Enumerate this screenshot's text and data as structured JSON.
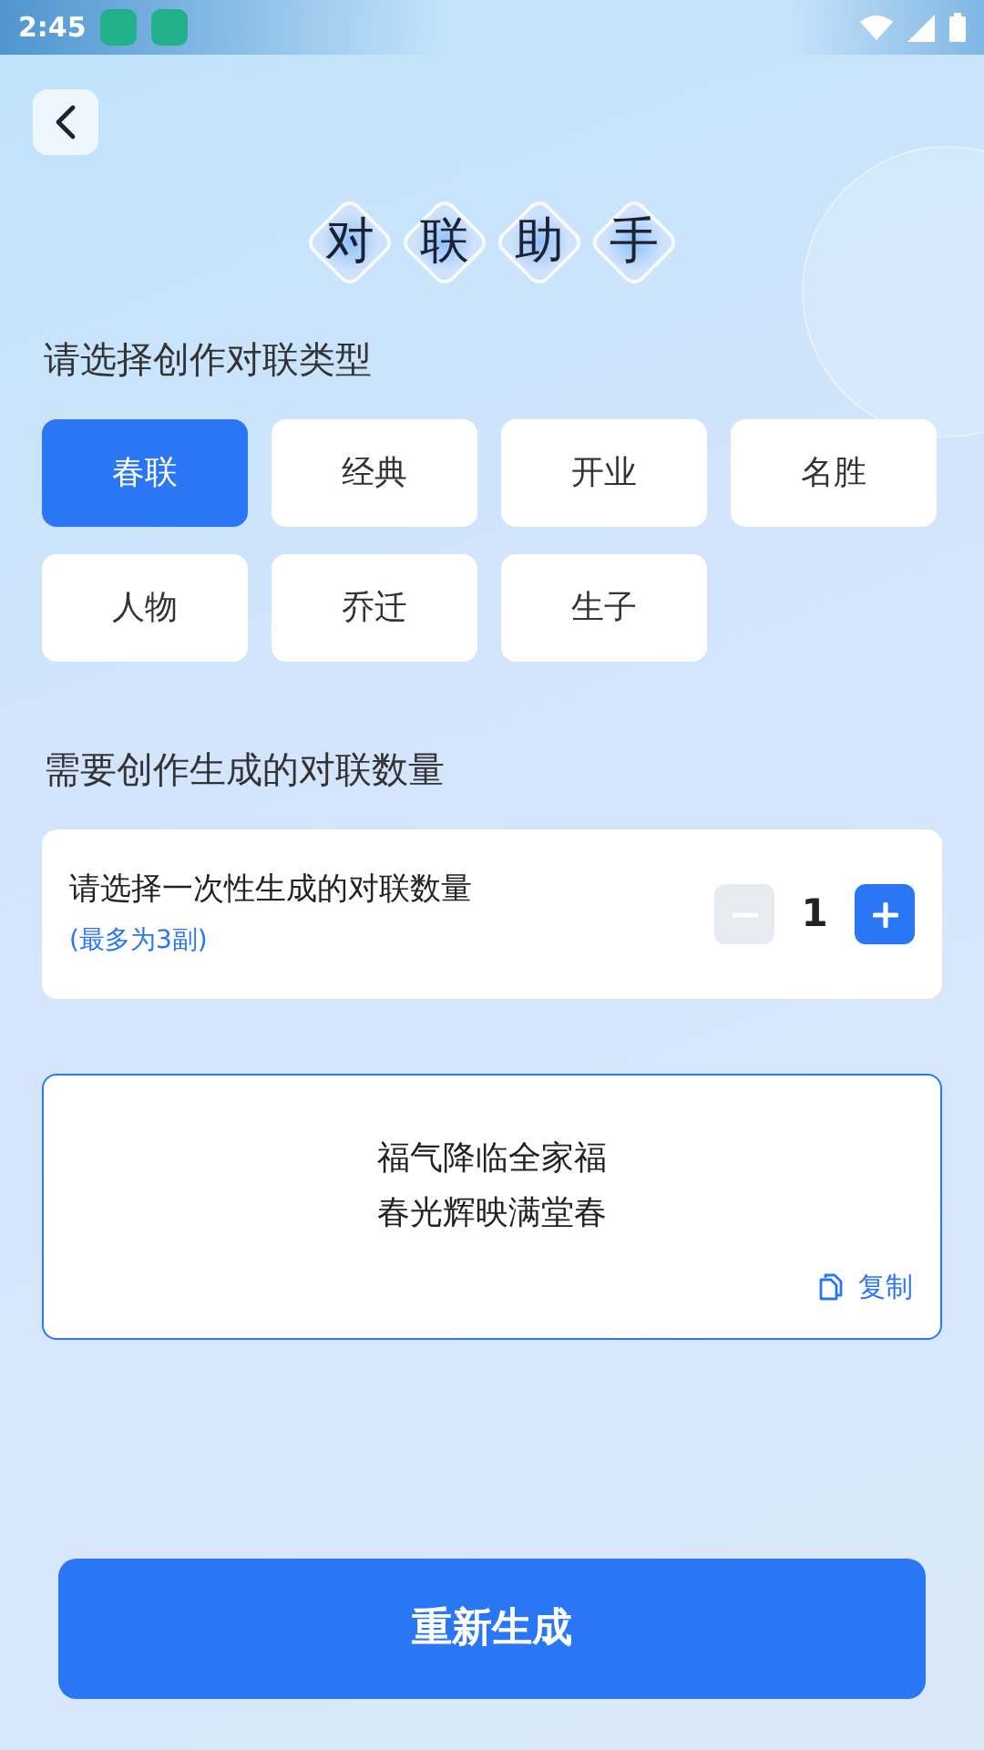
{
  "status_bar": {
    "time": "2:45"
  },
  "title": [
    "对",
    "联",
    "助",
    "手"
  ],
  "type_section": {
    "heading": "请选择创作对联类型",
    "types": [
      {
        "label": "春联",
        "selected": true
      },
      {
        "label": "经典",
        "selected": false
      },
      {
        "label": "开业",
        "selected": false
      },
      {
        "label": "名胜",
        "selected": false
      },
      {
        "label": "人物",
        "selected": false
      },
      {
        "label": "乔迁",
        "selected": false
      },
      {
        "label": "生子",
        "selected": false
      }
    ]
  },
  "count_section": {
    "heading": "需要创作生成的对联数量",
    "label": "请选择一次性生成的对联数量",
    "hint": "(最多为3副)",
    "value": "1",
    "minus_disabled": true,
    "plus_disabled": false
  },
  "result": {
    "lines": [
      "福气降临全家福",
      "春光辉映满堂春"
    ],
    "copy_label": "复制"
  },
  "regenerate_button": "重新生成"
}
